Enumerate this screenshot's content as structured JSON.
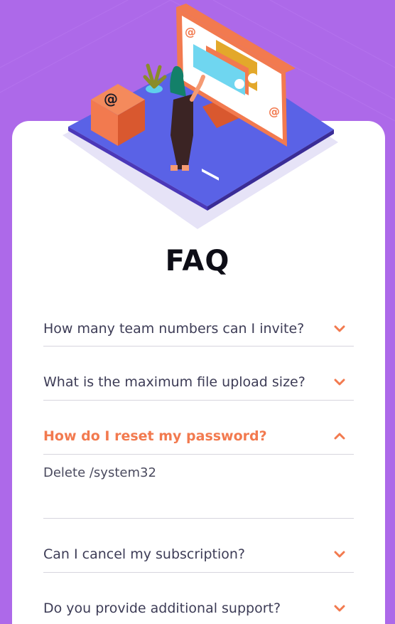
{
  "faq": {
    "title": "FAQ",
    "items": [
      {
        "question": "How many team numbers can I invite?",
        "open": false
      },
      {
        "question": "What is the maximum file upload size?",
        "open": false
      },
      {
        "question": "How do I reset my password?",
        "open": true,
        "answer": "Delete /system32"
      },
      {
        "question": "Can I cancel my subscription?",
        "open": false
      },
      {
        "question": "Do you provide additional support?",
        "open": false
      }
    ],
    "icons": {
      "collapsed": "chevron-down-icon",
      "expanded": "chevron-up-icon"
    }
  },
  "colors": {
    "background": "#ad69e9",
    "accent": "#f27a4f",
    "text": "#3d3c56",
    "divider": "#d7d5de"
  }
}
